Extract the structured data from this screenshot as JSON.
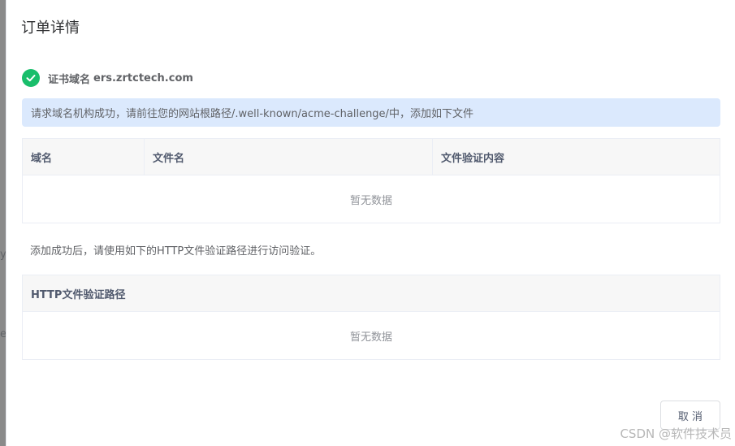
{
  "backdrop": {
    "fragments": [
      "y",
      "e"
    ]
  },
  "dialog": {
    "title": "订单详情",
    "cert_label": "证书域名",
    "cert_domain": "ers.zrtctech.com",
    "alert_text": "请求域名机构成功，请前往您的网站根路径/.well-known/acme-challenge/中，添加如下文件",
    "file_table": {
      "columns": [
        "域名",
        "文件名",
        "文件验证内容"
      ],
      "empty_text": "暂无数据"
    },
    "hint_text": "添加成功后，请使用如下的HTTP文件验证路径进行访问验证。",
    "path_table": {
      "columns": [
        "HTTP文件验证路径"
      ],
      "empty_text": "暂无数据"
    },
    "cancel_label": "取 消"
  },
  "watermark": "CSDN @软件技术员",
  "colors": {
    "success": "#19be6b",
    "alert_bg": "#dbe9fd",
    "table_header_bg": "#f7f7f7"
  },
  "icons": {
    "status": "check-circle-icon"
  }
}
